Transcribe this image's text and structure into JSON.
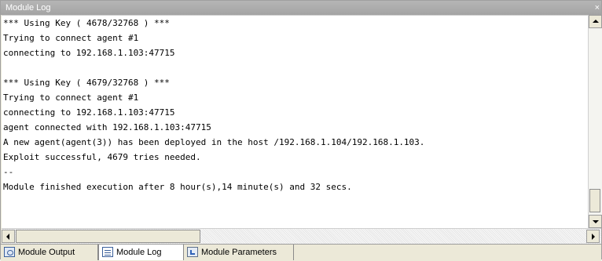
{
  "panel": {
    "title": "Module Log",
    "pin_glyph": "ᅟ⊥",
    "close_glyph": "×"
  },
  "log": {
    "lines": [
      "*** Using Key ( 4678/32768 ) ***",
      "Trying to connect agent #1",
      "connecting to 192.168.1.103:47715",
      "",
      "*** Using Key ( 4679/32768 ) ***",
      "Trying to connect agent #1",
      "connecting to 192.168.1.103:47715",
      "agent connected with 192.168.1.103:47715",
      "A new agent(agent(3)) has been deployed in the host /192.168.1.104/192.168.1.103.",
      "Exploit successful, 4679 tries needed.",
      "--",
      "Module finished execution after 8 hour(s),14 minute(s) and 32 secs."
    ]
  },
  "tabs": [
    {
      "label": "Module Output",
      "icon": "module-output-icon",
      "active": false
    },
    {
      "label": "Module Log",
      "icon": "module-log-icon",
      "active": true
    },
    {
      "label": "Module Parameters",
      "icon": "module-parameters-icon",
      "active": false
    }
  ],
  "colors": {
    "titlebar": "#a8a8a8",
    "background": "#ffffff",
    "chrome": "#ece9d8"
  }
}
